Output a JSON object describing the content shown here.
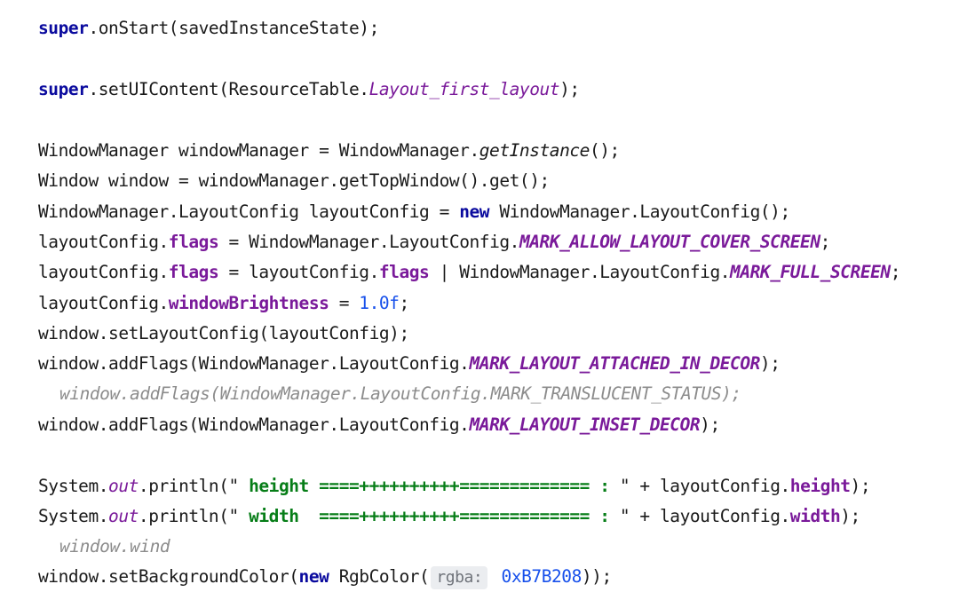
{
  "editor": {
    "lines": {
      "l1": {
        "kw": "super",
        "rest": ".onStart(savedInstanceState);"
      },
      "l2": {
        "kw": "super",
        "a": ".setUIContent(ResourceTable.",
        "c": "Layout_first_layout",
        "b": ");"
      },
      "l3": {
        "a": "WindowManager windowManager = WindowManager.",
        "i": "getInstance",
        "b": "();"
      },
      "l4": {
        "a": "Window window = windowManager.getTopWindow().get();"
      },
      "l5": {
        "a": "WindowManager.LayoutConfig layoutConfig = ",
        "kw": "new",
        "b": " WindowManager.LayoutConfig();"
      },
      "l6": {
        "a": "layoutConfig.",
        "f": "flags",
        "b": " = WindowManager.LayoutConfig.",
        "c": "MARK_ALLOW_LAYOUT_COVER_SCREEN",
        "d": ";"
      },
      "l7": {
        "a": "layoutConfig.",
        "f1": "flags",
        "b": " = layoutConfig.",
        "f2": "flags",
        "p": " | ",
        "c": "WindowManager.LayoutConfig.",
        "k": "MARK_FULL_SCREEN",
        "d": ";"
      },
      "l8": {
        "a": "layoutConfig.",
        "f": "windowBrightness",
        "b": " = ",
        "n": "1.0f",
        "d": ";"
      },
      "l9": {
        "a": "window.setLayoutConfig(layoutConfig);"
      },
      "l10": {
        "a": "window.addFlags(WindowManager.LayoutConfig.",
        "c": "MARK_LAYOUT_ATTACHED_IN_DECOR",
        "d": ");"
      },
      "l11": {
        "comment": "window.addFlags(WindowManager.LayoutConfig.MARK_TRANSLUCENT_STATUS);"
      },
      "l12": {
        "a": "window.addFlags(WindowManager.LayoutConfig.",
        "c": "MARK_LAYOUT_INSET_DECOR",
        "d": ");"
      },
      "l13": {
        "a": "System.",
        "s": "out",
        "b": ".println(\"",
        "str": " height ====++++++++++============= : ",
        "e": "\" + layoutConfig.",
        "f": "height",
        "d": ");"
      },
      "l14": {
        "a": "System.",
        "s": "out",
        "b": ".println(\"",
        "str": " width  ====++++++++++============= : ",
        "e": "\" + layoutConfig.",
        "f": "width",
        "d": ");"
      },
      "l15": {
        "comment": "window.wind"
      },
      "l16": {
        "a": "window.setBackgroundColor(",
        "kw": "new",
        "b": " RgbColor(",
        "hint": "rgba:",
        "n": " 0xB7B208",
        "d": "));"
      }
    }
  },
  "colors": {
    "keyword": "#0a0a9e",
    "field": "#7a1a9a",
    "number": "#1750eb",
    "string": "#067d17",
    "comment": "#8c8c8c",
    "hint_bg": "#ebedf0"
  }
}
